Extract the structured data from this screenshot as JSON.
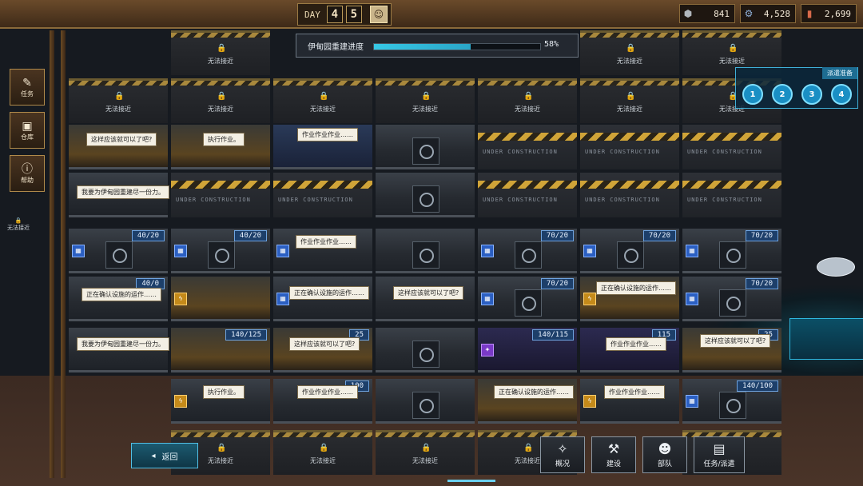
{
  "topbar": {
    "day_label": "DAY",
    "day_digits": [
      "4",
      "5"
    ],
    "day_icon": "character-portrait-icon",
    "resources": [
      {
        "icon": "shield-icon",
        "value": "841",
        "color": "#b0b6bc"
      },
      {
        "icon": "gear-icon",
        "value": "4,528",
        "color": "#8fb0d8"
      },
      {
        "icon": "battery-icon",
        "value": "2,699",
        "color": "#d86a4a"
      }
    ]
  },
  "rebuild": {
    "label": "伊甸园重建进度",
    "percent_text": "58%",
    "progress": 0.58
  },
  "side_menu": [
    {
      "label": "任务",
      "icon": "notebook-icon"
    },
    {
      "label": "仓库",
      "icon": "storage-box-icon"
    },
    {
      "label": "帮助",
      "icon": "info-icon"
    }
  ],
  "left_lock_text": "无法接近",
  "dispatch": {
    "title": "派遣准备",
    "slots": [
      "1",
      "2",
      "3",
      "4"
    ]
  },
  "locked_text": "无法接近",
  "capacities": {
    "c40": "40/20",
    "c70": "70/20",
    "c70b": "70/20",
    "c140": "140/125",
    "c140b": "140/115",
    "c140c": "140/100",
    "c40b": "40/0",
    "c115": "115",
    "c25": "25",
    "c100": "100"
  },
  "bubbles": {
    "b1": "这样应该就可以了吧?",
    "b2": "执行作业。",
    "b3": "作业作业作业……",
    "b4": "我要为伊甸园重建尽一份力。",
    "b5": "作业作业作业……",
    "b6": "正在确认设施的运作……",
    "b7": "正在确认设施的运作……",
    "b8": "这样应该就可以了吧?",
    "b9": "正在确认设施的运作……",
    "b10": "我要为伊甸园重建尽一份力。",
    "b11": "这样应该就可以了吧?",
    "b12": "作业作业作业……",
    "b13": "这样应该就可以了吧?",
    "b14": "执行作业。",
    "b15": "作业作业作业……",
    "b16": "正在确认设施的运作……",
    "b17": "作业作业作业……"
  },
  "bottom": {
    "back_label": "返回",
    "nav": [
      {
        "label": "概况",
        "icon": "compass-icon"
      },
      {
        "label": "建设",
        "icon": "hammer-icon"
      },
      {
        "label": "部队",
        "icon": "squad-icon"
      },
      {
        "label": "任务/派遣",
        "icon": "document-icon"
      }
    ]
  }
}
